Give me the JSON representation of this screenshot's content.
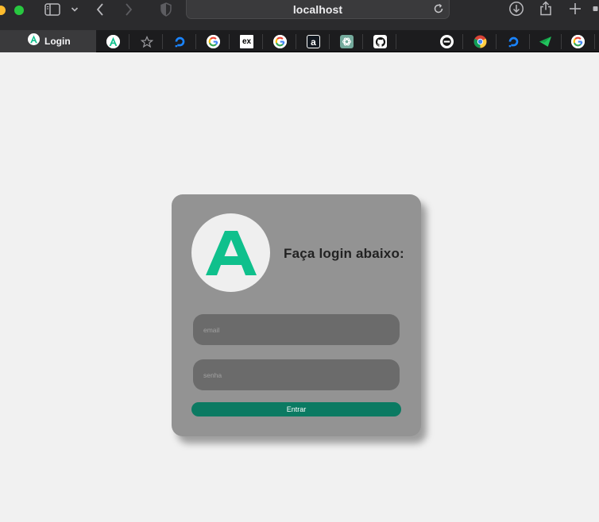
{
  "browser": {
    "url": "localhost",
    "active_tab": {
      "label": "Login",
      "icon": "angular-icon"
    },
    "toolbar_icons": [
      "sidebar-icon",
      "chevron-down-icon",
      "back-icon",
      "forward-icon",
      "shield-icon",
      "reload-icon",
      "download-icon",
      "share-icon",
      "new-tab-icon"
    ],
    "pinned_tabs": [
      "angular-icon",
      "star-icon",
      "digitalocean-icon",
      "google-icon",
      "ex-icon",
      "google-icon",
      "amazon-icon",
      "chatgpt-icon",
      "github-icon",
      "circle-icon",
      "chrome-icon",
      "digitalocean-icon",
      "send-icon",
      "google-icon"
    ],
    "pinned_ex_text": "ex",
    "pinned_amz_text": "a"
  },
  "login": {
    "heading": "Faça login abaixo:",
    "logo_letter": "A",
    "email_placeholder": "email",
    "password_placeholder": "senha",
    "submit_label": "Entrar"
  },
  "colors": {
    "page_bg": "#f1f1f1",
    "card_bg": "#939393",
    "field_bg": "#6b6b6b",
    "button_bg": "#0b7a62",
    "logo_green": "#0fc08c"
  }
}
